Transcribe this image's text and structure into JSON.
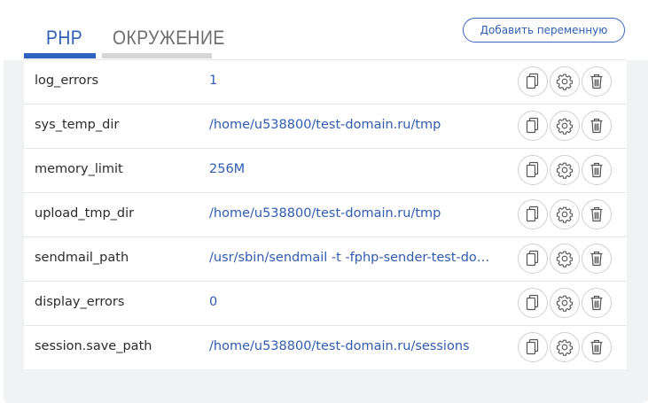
{
  "tabs": [
    {
      "label": "PHP",
      "active": true
    },
    {
      "label": "ОКРУЖЕНИЕ",
      "active": false
    }
  ],
  "add_button_label": "Добавить переменную",
  "colors": {
    "accent": "#2f62c1",
    "value_text": "#2f5bb0",
    "name_text": "#2b2b2b",
    "inactive_tab": "#d6d6d6"
  },
  "row_actions": [
    "copy-icon",
    "gear-icon",
    "trash-icon"
  ],
  "variables": [
    {
      "name": "log_errors",
      "value": "1"
    },
    {
      "name": "sys_temp_dir",
      "value": "/home/u538800/test-domain.ru/tmp"
    },
    {
      "name": "memory_limit",
      "value": "256M"
    },
    {
      "name": "upload_tmp_dir",
      "value": "/home/u538800/test-domain.ru/tmp"
    },
    {
      "name": "sendmail_path",
      "value": "/usr/sbin/sendmail -t -fphp-sender-test-doma..."
    },
    {
      "name": "display_errors",
      "value": "0"
    },
    {
      "name": "session.save_path",
      "value": "/home/u538800/test-domain.ru/sessions"
    }
  ]
}
